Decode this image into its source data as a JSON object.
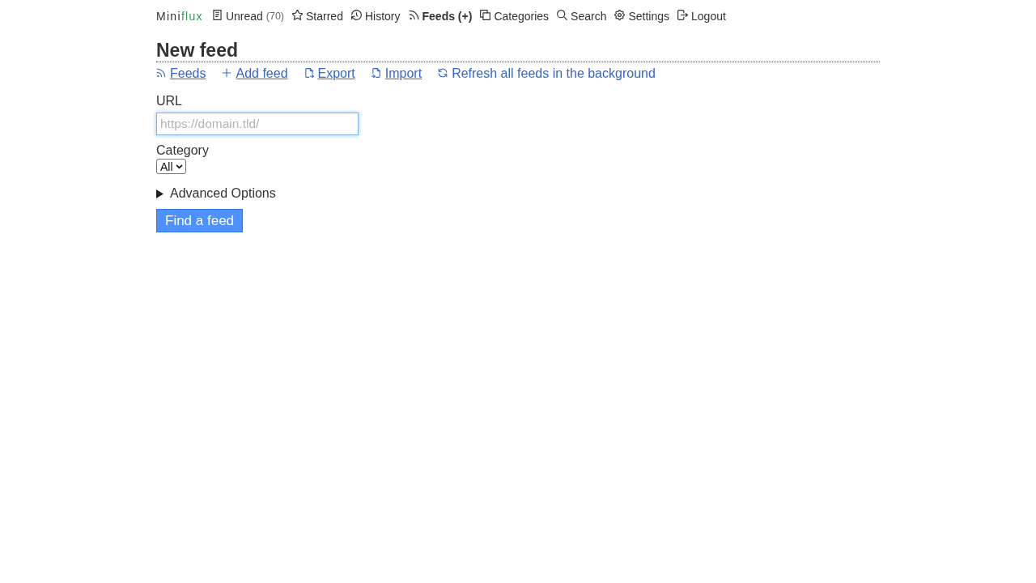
{
  "header": {
    "logo": {
      "text": "Mini",
      "accent": "flux"
    },
    "nav": [
      {
        "label": "Unread",
        "count": "(70)",
        "selected": false
      },
      {
        "label": "Starred",
        "selected": false
      },
      {
        "label": "History",
        "selected": false
      },
      {
        "label": "Feeds (+)",
        "selected": true
      },
      {
        "label": "Categories",
        "selected": false
      },
      {
        "label": "Search",
        "selected": false
      },
      {
        "label": "Settings",
        "selected": false
      },
      {
        "label": "Logout",
        "selected": false
      }
    ]
  },
  "page": {
    "title": "New feed",
    "menu": [
      {
        "label": "Feeds",
        "kind": "link"
      },
      {
        "label": "Add feed",
        "kind": "link"
      },
      {
        "label": "Export",
        "kind": "link"
      },
      {
        "label": "Import",
        "kind": "link"
      },
      {
        "label": "Refresh all feeds in the background",
        "kind": "action"
      }
    ],
    "form": {
      "url": {
        "label": "URL",
        "placeholder": "https://domain.tld/",
        "focused": true
      },
      "category": {
        "label": "Category",
        "value": "All"
      },
      "advanced": {
        "label": "Advanced Options",
        "expanded": false
      },
      "submit": "Find a feed"
    }
  }
}
